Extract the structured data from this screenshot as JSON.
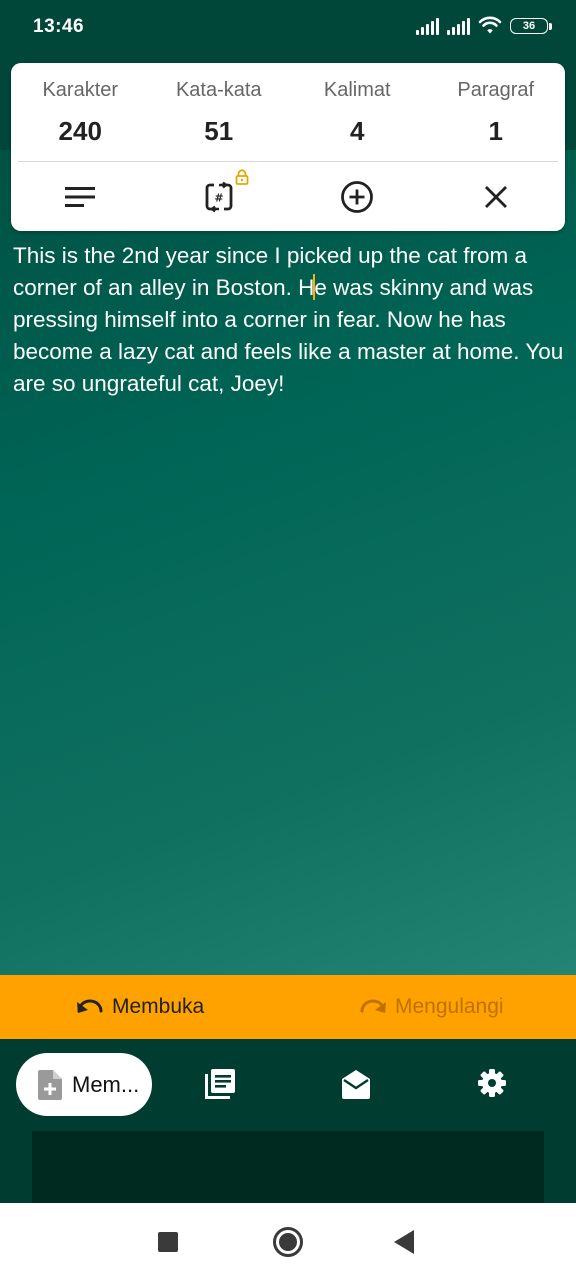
{
  "status": {
    "time": "13:46",
    "battery": "36",
    "icons": [
      "signal-icon",
      "signal-icon",
      "wifi-icon",
      "battery-icon"
    ]
  },
  "stats": [
    {
      "label": "Karakter",
      "value": "240"
    },
    {
      "label": "Kata-kata",
      "value": "51"
    },
    {
      "label": "Kalimat",
      "value": "4"
    },
    {
      "label": "Paragraf",
      "value": "1"
    }
  ],
  "toolbar": {
    "icons": [
      "align-left-icon",
      "number-replace-icon",
      "lock-icon",
      "add-circle-icon",
      "close-icon"
    ],
    "lock_color": "#e6a800"
  },
  "editor": {
    "text_before_cursor": "This is the 2nd year since I picked up the cat from a corner of an alley in Boston. H",
    "text_after_cursor": "e was skinny and was pressing himself into a corner in fear. Now he has become a lazy cat and feels like a master at home. You are so ungrateful cat, Joey!",
    "cursor_color": "#ffb000"
  },
  "history": {
    "undo_label": "Membuka",
    "redo_label": "Mengulangi",
    "bar_color": "#ffa200"
  },
  "bottom_nav": {
    "active_label": "Mem...",
    "icons": [
      "new-document-icon",
      "library-icon",
      "mail-open-icon",
      "settings-icon"
    ]
  },
  "system_nav": {
    "icons": [
      "recents-icon",
      "home-icon",
      "back-icon"
    ]
  },
  "colors": {
    "top_band": "#00473a",
    "gradient_dark": "#004a3c",
    "gradient_light": "#3a9a88",
    "bottom_nav": "#003d30"
  }
}
